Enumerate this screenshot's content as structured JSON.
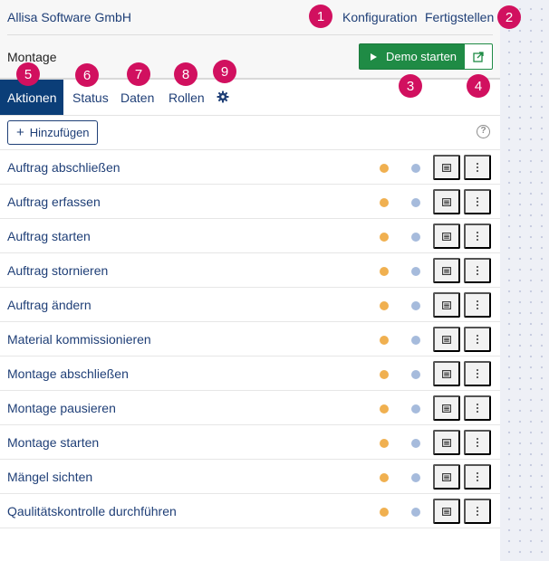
{
  "header": {
    "company": "Allisa Software GmbH",
    "configuration_link": "Konfiguration",
    "finish_link": "Fertigstellen"
  },
  "section": {
    "title": "Montage",
    "demo_button_label": "Demo starten"
  },
  "tabs": [
    {
      "label": "Aktionen",
      "active": true
    },
    {
      "label": "Status"
    },
    {
      "label": "Daten"
    },
    {
      "label": "Rollen"
    }
  ],
  "toolbar": {
    "add_button_label": "Hinzufügen",
    "help_label": "?"
  },
  "actions": [
    "Auftrag abschließen",
    "Auftrag erfassen",
    "Auftrag starten",
    "Auftrag stornieren",
    "Auftrag ändern",
    "Material kommissionieren",
    "Montage abschließen",
    "Montage pausieren",
    "Montage starten",
    "Mängel sichten",
    "Qaulitätskontrolle durchführen"
  ],
  "badges": [
    "1",
    "2",
    "3",
    "4",
    "5",
    "6",
    "7",
    "8",
    "9"
  ],
  "colors": {
    "primary_text": "#1f3f77",
    "active_tab": "#0b3e78",
    "demo_green": "#1f8b45",
    "badge": "#d1105f",
    "dot_orange": "#f0b050",
    "dot_blue": "#a6bbdc"
  },
  "icons": {
    "demo": "play-icon",
    "external": "external-link-icon",
    "settings": "gear-icon",
    "detail": "list-detail-icon",
    "more": "kebab-menu-icon"
  }
}
